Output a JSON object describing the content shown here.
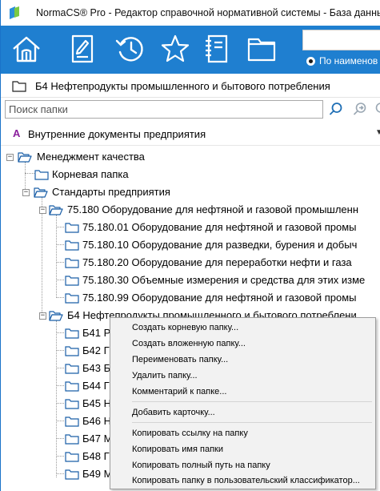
{
  "window": {
    "title": "NormaCS® Pro - Редактор справочной нормативной системы - База данных"
  },
  "toolbar": {
    "buttons": [
      "home-icon",
      "document-edit-icon",
      "history-icon",
      "star-icon",
      "notebook-icon",
      "folder-icon"
    ],
    "search_value": "",
    "search_mode_label": "По наименов"
  },
  "breadcrumb": {
    "text": "Б4 Нефтепродукты промышленного и бытового потребления"
  },
  "folder_search": {
    "placeholder": "Поиск папки"
  },
  "internal_docs": {
    "marker": "A",
    "label": "Внутренние документы предприятия"
  },
  "tree": {
    "root": "Менеджмент качества",
    "root_folder": "Корневая папка",
    "standards": "Стандарты предприятия",
    "group_75180": "75.180  Оборудование для нефтяной и газовой промышленн",
    "sub_75180": [
      "75.180.01  Оборудование для нефтяной и газовой промы",
      "75.180.10  Оборудование для разведки, бурения и добыч",
      "75.180.20  Оборудование для переработки нефти и газа",
      "75.180.30  Объемные измерения и средства для этих изме",
      "75.180.99  Оборудование для нефтяной и газовой промы"
    ],
    "group_b4": "Б4 Нефтепродукты промышленного и бытового потреблени",
    "sub_b4": [
      "Б41 Р",
      "Б42 Г",
      "Б43 Б",
      "Б44 Г",
      "Б45 Н",
      "Б46 Н",
      "Б47 М",
      "Б48 Г",
      "Б49 М"
    ]
  },
  "context_menu": {
    "items": [
      "Создать корневую папку...",
      "Создать вложенную папку...",
      "Переименовать папку...",
      "Удалить папку...",
      "Комментарий к папке...",
      "Добавить карточку...",
      "Копировать ссылку на папку",
      "Копировать имя папки",
      "Копировать полный путь на папку",
      "Копировать папку в пользовательский классификатор..."
    ]
  },
  "colors": {
    "toolbar": "#1f7fd0",
    "folder_outline": "#1b5fa8",
    "menu_bg": "#f2f2f2"
  }
}
